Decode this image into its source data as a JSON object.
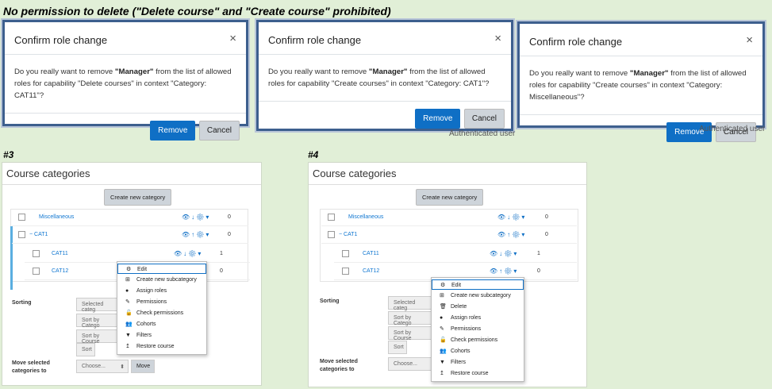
{
  "heading": "No permission to delete (\"Delete course\" and \"Create course\" prohibited)",
  "dialogs": [
    {
      "title": "Confirm role change",
      "close": "×",
      "msg_pre": "Do you really want to remove ",
      "msg_bold": "\"Manager\"",
      "msg_post": " from the list of allowed roles for capability \"Delete courses\" in context \"Category: CAT11\"?",
      "remove": "Remove",
      "cancel": "Cancel"
    },
    {
      "title": "Confirm role change",
      "close": "×",
      "msg_pre": "Do you really want to remove ",
      "msg_bold": "\"Manager\"",
      "msg_post": " from the list of allowed roles for capability \"Create courses\" in context \"Category: CAT1\"?",
      "remove": "Remove",
      "cancel": "Cancel"
    },
    {
      "title": "Confirm role change",
      "close": "×",
      "msg_pre": "Do you really want to remove ",
      "msg_bold": "\"Manager\"",
      "msg_post": " from the list of allowed roles for capability \"Create courses\" in context \"Category: Miscellaneous\"?",
      "remove": "Remove",
      "cancel": "Cancel"
    }
  ],
  "under_texts": [
    "Authenticated user",
    "Authenticated user"
  ],
  "panels": [
    {
      "label": "#3",
      "title": "Course categories",
      "create_btn": "Create new category",
      "rows": [
        {
          "name": "Miscellaneous",
          "count": "0"
        },
        {
          "name": "− CAT1",
          "count": "0"
        },
        {
          "name": "CAT11",
          "count": "1"
        },
        {
          "name": "CAT12",
          "count": "0"
        }
      ],
      "sorting_label": "Sorting",
      "sort_fields": [
        "Selected categ",
        "Sort by Catego",
        "Sort by Course"
      ],
      "sort_btn": "Sort",
      "move_label": "Move selected categories to",
      "choose": "Choose...",
      "move_btn": "Move",
      "menu": [
        "Edit",
        "Create new subcategory",
        "Assign roles",
        "Permissions",
        "Check permissions",
        "Cohorts",
        "Filters",
        "Restore course"
      ]
    },
    {
      "label": "#4",
      "title": "Course categories",
      "create_btn": "Create new category",
      "rows": [
        {
          "name": "Miscellaneous",
          "count": "0"
        },
        {
          "name": "− CAT1",
          "count": "0"
        },
        {
          "name": "CAT11",
          "count": "1"
        },
        {
          "name": "CAT12",
          "count": "0"
        }
      ],
      "sorting_label": "Sorting",
      "sort_fields": [
        "Selected categ",
        "Sort by Catego",
        "Sort by Course"
      ],
      "sort_btn": "Sort",
      "move_label": "Move selected categories to",
      "choose": "Choose...",
      "move_btn": "",
      "menu": [
        "Edit",
        "Create new subcategory",
        "Delete",
        "Assign roles",
        "Permissions",
        "Check permissions",
        "Cohorts",
        "Filters",
        "Restore course"
      ]
    }
  ],
  "menu_icons_3": [
    "gear-icon",
    "plus-square-icon",
    "user-icon",
    "edit-icon",
    "unlock-icon",
    "users-icon",
    "filter-icon",
    "restore-icon"
  ],
  "menu_icons_4": [
    "gear-icon",
    "plus-square-icon",
    "trash-icon",
    "user-icon",
    "edit-icon",
    "unlock-icon",
    "users-icon",
    "filter-icon",
    "restore-icon"
  ]
}
